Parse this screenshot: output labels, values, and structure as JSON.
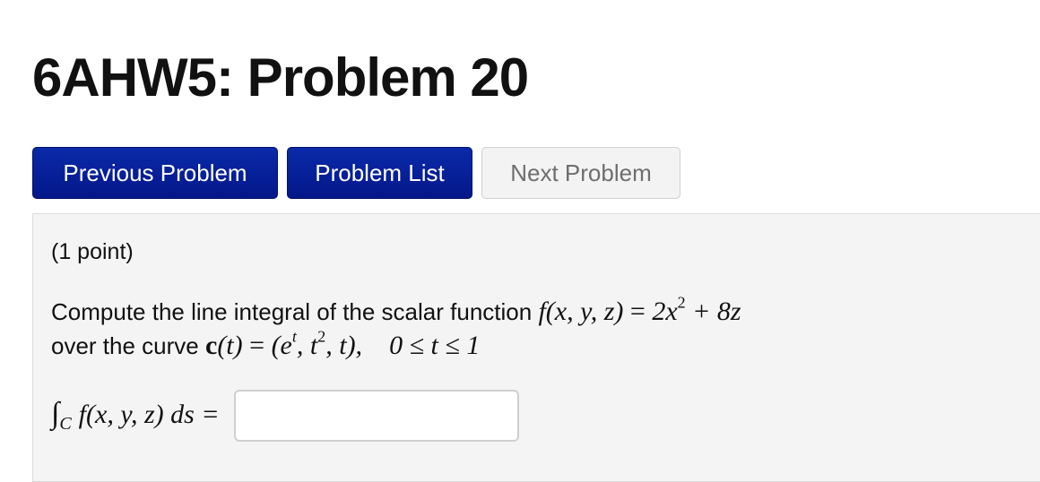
{
  "page": {
    "title": "6AHW5: Problem 20"
  },
  "nav": {
    "previous_label": "Previous Problem",
    "list_label": "Problem List",
    "next_label": "Next Problem"
  },
  "problem": {
    "points": "(1 point)",
    "intro": "Compute the line integral of the scalar function",
    "function_lhs": "f(x, y, z)",
    "equals": "=",
    "function_rhs_a": "2x",
    "function_rhs_exp": "2",
    "function_rhs_b": "+ 8z",
    "curve_intro": "over the curve",
    "curve_name": "c",
    "curve_arg": "(t)",
    "curve_def_a": "(e",
    "curve_def_exp1": "t",
    "curve_def_b": ", t",
    "curve_def_exp2": "2",
    "curve_def_c": ", t),",
    "range": "0 ≤ t ≤ 1",
    "integral_sign": "∫",
    "integral_sub": "C",
    "integral_body": "f(x, y, z) ds ="
  },
  "answer": {
    "value": "",
    "placeholder": ""
  }
}
